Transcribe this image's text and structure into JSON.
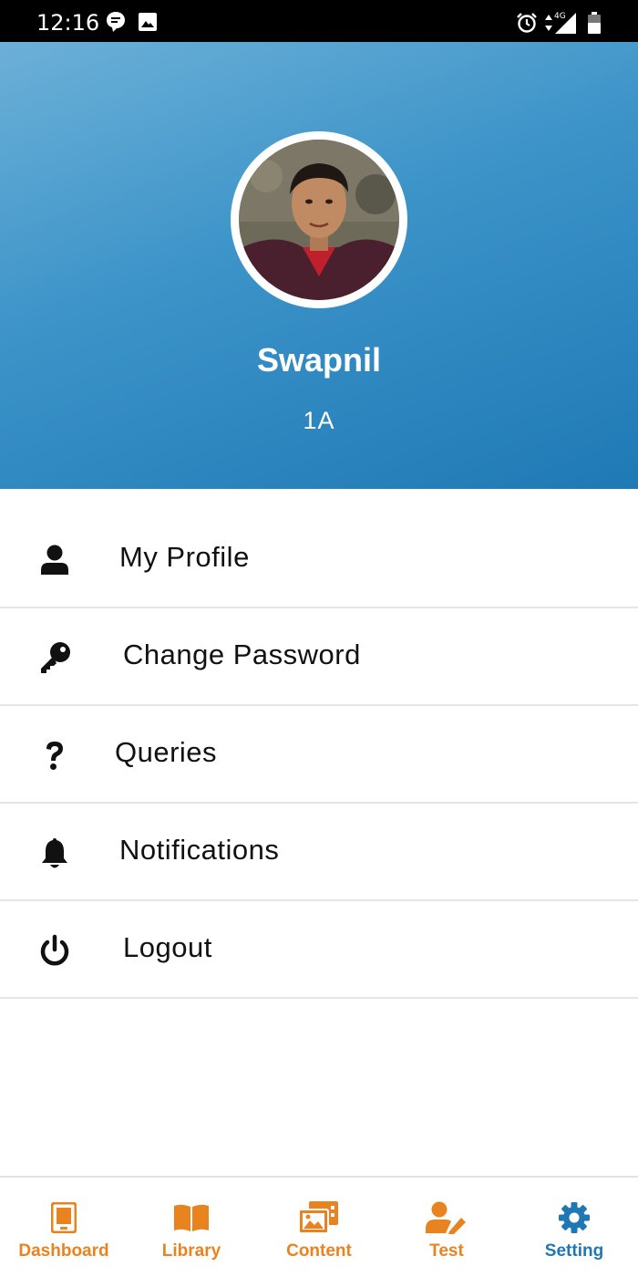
{
  "status_bar": {
    "time": "12:16",
    "left_icons": [
      "chat-notification-icon",
      "image-notification-icon"
    ],
    "right_icons": [
      "alarm-icon",
      "data-arrows-icon",
      "signal-4g-icon",
      "battery-icon"
    ],
    "network": "4G"
  },
  "profile": {
    "name": "Swapnil",
    "class": "1A",
    "avatar": "avatar-photo"
  },
  "menu": {
    "items": [
      {
        "label": "My Profile",
        "icon": "person-icon"
      },
      {
        "label": "Change Password",
        "icon": "key-icon"
      },
      {
        "label": "Queries",
        "icon": "question-icon"
      },
      {
        "label": "Notifications",
        "icon": "bell-icon"
      },
      {
        "label": "Logout",
        "icon": "power-icon"
      }
    ]
  },
  "bottom_nav": {
    "items": [
      {
        "label": "Dashboard",
        "icon": "tablet-icon",
        "active": false
      },
      {
        "label": "Library",
        "icon": "book-icon",
        "active": false
      },
      {
        "label": "Content",
        "icon": "images-icon",
        "active": false
      },
      {
        "label": "Test",
        "icon": "user-edit-icon",
        "active": false
      },
      {
        "label": "Setting",
        "icon": "gear-icon",
        "active": true
      }
    ]
  },
  "colors": {
    "accent_orange": "#e8831f",
    "active_blue": "#1f78b4",
    "header_blue": "#2a86c0"
  }
}
